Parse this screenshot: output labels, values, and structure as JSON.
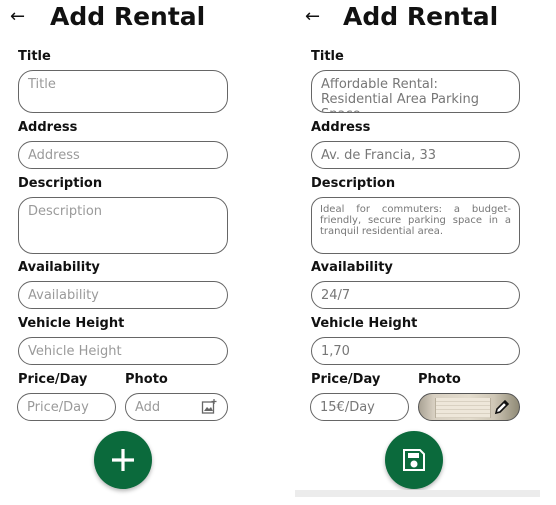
{
  "left": {
    "header": {
      "back_icon": "arrow-left-icon",
      "title": "Add Rental"
    },
    "fields": {
      "title": {
        "label": "Title",
        "placeholder": "Title"
      },
      "address": {
        "label": "Address",
        "placeholder": "Address"
      },
      "description": {
        "label": "Description",
        "placeholder": "Description"
      },
      "availability": {
        "label": "Availability",
        "placeholder": "Availability"
      },
      "vehicle_height": {
        "label": "Vehicle Height",
        "placeholder": "Vehicle Height"
      },
      "price": {
        "label": "Price/Day",
        "placeholder": "Price/Day"
      },
      "photo": {
        "label": "Photo",
        "placeholder": "Add",
        "icon": "add-image-icon"
      }
    },
    "fab": {
      "icon": "plus-icon"
    }
  },
  "right": {
    "header": {
      "back_icon": "arrow-left-icon",
      "title": "Add Rental"
    },
    "fields": {
      "title": {
        "label": "Title",
        "value": "Affordable Rental: Residential Area Parking Space"
      },
      "address": {
        "label": "Address",
        "value": "Av. de Francia, 33"
      },
      "description": {
        "label": "Description",
        "value": "Ideal for commuters: a budget-friendly, secure parking space in a tranquil residential area."
      },
      "availability": {
        "label": "Availability",
        "value": "24/7"
      },
      "vehicle_height": {
        "label": "Vehicle Height",
        "value": "1,70"
      },
      "price": {
        "label": "Price/Day",
        "value": "15€/Day"
      },
      "photo": {
        "label": "Photo",
        "icon": "edit-pencil-icon"
      }
    },
    "fab": {
      "icon": "save-icon"
    }
  },
  "colors": {
    "accent": "#0b6a3c"
  }
}
